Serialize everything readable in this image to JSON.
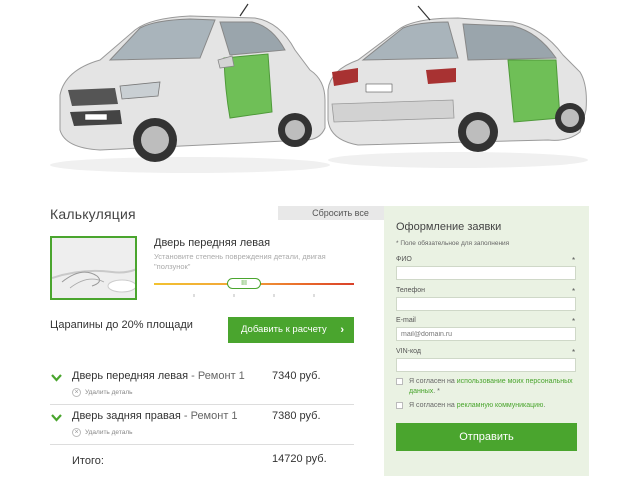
{
  "calculator": {
    "title": "Калькуляция",
    "reset_label": "Сбросить все",
    "part": {
      "name": "Дверь передняя левая",
      "hint": "Установите степень повреждения детали, двигая \"ползунок\"",
      "slider_knob_label": "III",
      "damage_level": 0.45
    },
    "damage_description": "Царапины до 20% площади",
    "add_label": "Добавить к расчету",
    "add_chevron": "›",
    "repairs": [
      {
        "name": "Дверь передняя левая",
        "type": " - Ремонт 1",
        "price": "7340 руб.",
        "remove_label": "Удалить деталь",
        "remove_icon": "×"
      },
      {
        "name": "Дверь задняя правая",
        "type": " - Ремонт 1",
        "price": "7380 руб.",
        "remove_label": "Удалить деталь",
        "remove_icon": "×"
      }
    ],
    "total_label": "Итого:",
    "total_value": "14720 руб."
  },
  "order_form": {
    "title": "Оформление заявки",
    "note": "* Поле обязательное для заполнения",
    "fields": [
      {
        "label": "ФИО",
        "required": "*",
        "value": "",
        "placeholder": ""
      },
      {
        "label": "Телефон",
        "required": "*",
        "value": "",
        "placeholder": ""
      },
      {
        "label": "E-mail",
        "required": "*",
        "value": "",
        "placeholder": "mail@domain.ru"
      },
      {
        "label": "VIN-код",
        "required": "*",
        "value": "",
        "placeholder": ""
      }
    ],
    "consent1_prefix": "Я согласен на ",
    "consent1_link": "использование моих персональных данных",
    "consent1_suffix": ". *",
    "consent2_prefix": "Я согласен на ",
    "consent2_link": "рекламную коммуникацию",
    "consent2_suffix": ".",
    "submit_label": "Отправить"
  },
  "colors": {
    "accent": "#4aa52e",
    "form_bg": "#eaf2e3",
    "car_body": "#dcdcdc",
    "damaged_panel": "#6fbf57"
  },
  "icons": {
    "car_front": "car-front-image",
    "car_back": "car-back-image",
    "expand": "chevron-down-icon",
    "remove": "close-circle-icon"
  }
}
